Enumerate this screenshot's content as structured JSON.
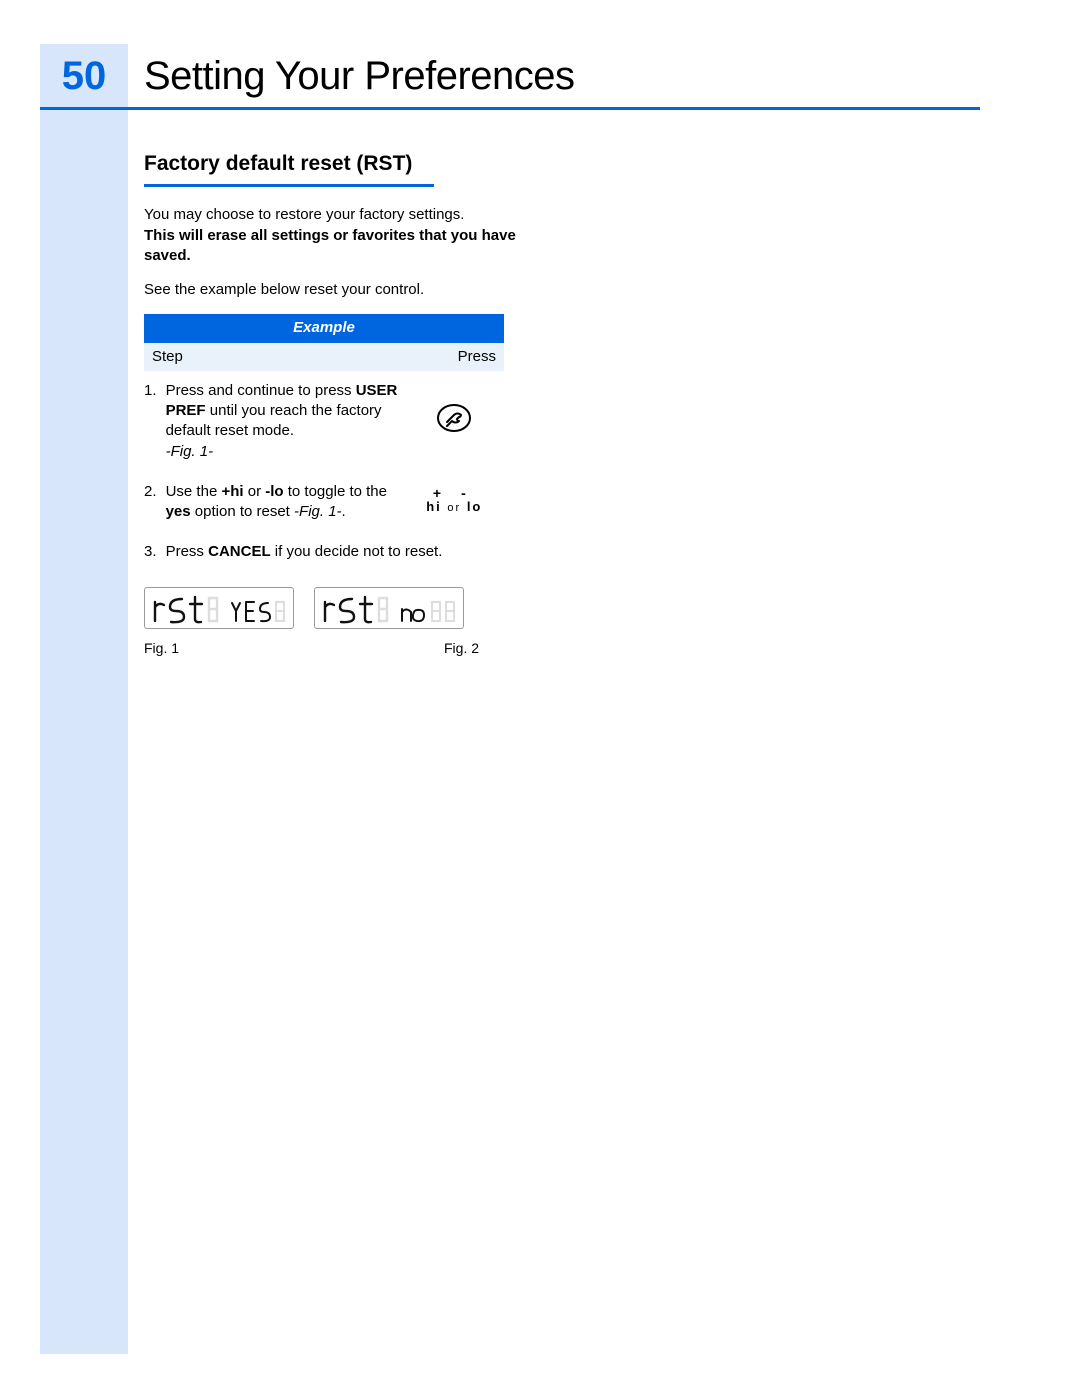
{
  "page_number": "50",
  "page_title": "Setting Your Preferences",
  "section_heading": "Factory default reset (RST)",
  "intro_line": "You may choose to restore your factory settings.",
  "warning_bold": "This will erase all settings or favorites that you have saved.",
  "see_example": "See the example below reset your control.",
  "table": {
    "header": "Example",
    "col_step": "Step",
    "col_press": "Press"
  },
  "steps": {
    "s1_num": "1.",
    "s1_a": "Press and continue to press ",
    "s1_b": "USER PREF",
    "s1_c": " until you reach the factory default reset mode.",
    "s1_fig": "-Fig. 1-",
    "s2_num": "2.",
    "s2_a": "Use the ",
    "s2_b": "+hi",
    "s2_c": " or ",
    "s2_d": "-lo",
    "s2_e": " to toggle to the ",
    "s2_f": "yes",
    "s2_g": " option to reset  ",
    "s2_fig": "-Fig. 1-",
    "s2_h": ".",
    "s3_num": "3.",
    "s3_a": "Press ",
    "s3_b": "CANCEL",
    "s3_c": " if you decide not to reset."
  },
  "hilo": {
    "plus": "+",
    "minus": "-",
    "hi": "hi",
    "or": "or",
    "lo": "lo"
  },
  "lcd": {
    "d1_main": "rSt",
    "d1_sub": "YES",
    "d2_main": "rSt",
    "d2_sub": "no"
  },
  "fig1": "Fig. 1",
  "fig2": "Fig. 2"
}
